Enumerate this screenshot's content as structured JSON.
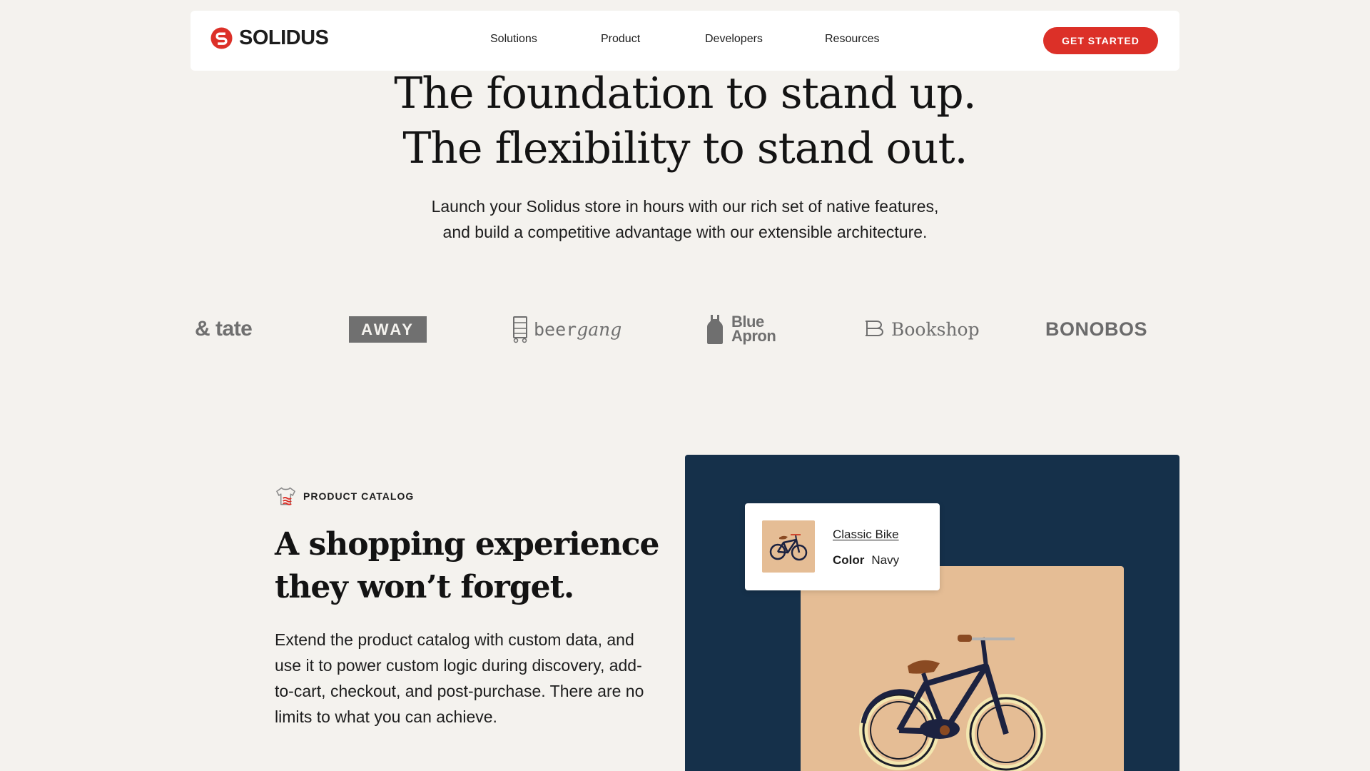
{
  "brand": {
    "name": "SOLIDUS",
    "accent_color": "#dc3028"
  },
  "nav": {
    "links": [
      "Solutions",
      "Product",
      "Developers",
      "Resources"
    ],
    "cta_label": "GET STARTED"
  },
  "hero": {
    "title_line1": "The foundation to stand up.",
    "title_line2": "The flexibility to stand out.",
    "subtitle_line1": "Launch your Solidus store in hours with our rich set of native features,",
    "subtitle_line2": "and build a competitive advantage with our extensible architecture."
  },
  "customer_logos": {
    "tate": "e & tate",
    "away": "AWAY",
    "beergang_prefix": "beer",
    "beergang_suffix": "gang",
    "blue_apron_line1": "Blue",
    "blue_apron_line2": "Apron",
    "bookshop": "Bookshop",
    "bonobos": "BONOBOS"
  },
  "feature": {
    "eyebrow": "PRODUCT CATALOG",
    "eyebrow_icon": "tshirt-icon",
    "title_line1": "A shopping experience",
    "title_line2": "they won’t forget.",
    "body": "Extend the product catalog with custom data, and use it to power custom logic during discovery, add-to-cart, checkout, and post-purchase. There are no limits to what you can achieve."
  },
  "showcase": {
    "panel_color": "#15304a",
    "stage_color": "#e5bd95",
    "product_name": "Classic Bike",
    "attribute_label": "Color",
    "attribute_value": "Navy"
  }
}
